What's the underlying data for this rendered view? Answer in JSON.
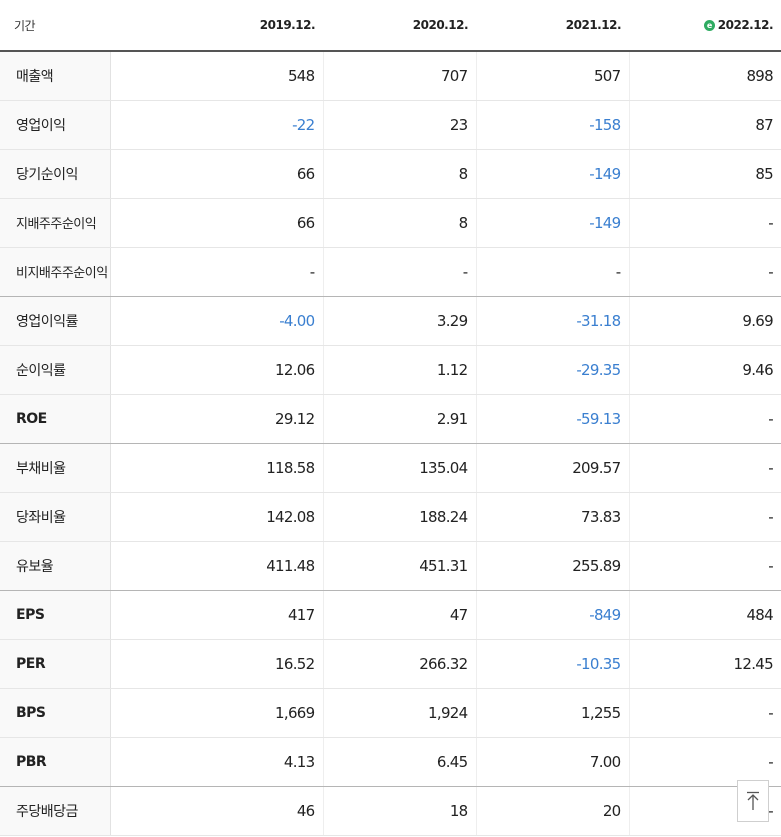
{
  "header": {
    "label": "기간",
    "periods": [
      "2019.12.",
      "2020.12.",
      "2021.12.",
      "2022.12."
    ],
    "estimate_icon": "estimate-badge-icon"
  },
  "rows": [
    {
      "label": "매출액",
      "values": [
        "548",
        "707",
        "507",
        "898"
      ]
    },
    {
      "label": "영업이익",
      "values": [
        "-22",
        "23",
        "-158",
        "87"
      ]
    },
    {
      "label": "당기순이익",
      "values": [
        "66",
        "8",
        "-149",
        "85"
      ]
    },
    {
      "label": "지배주주순이익",
      "values": [
        "66",
        "8",
        "-149",
        "-"
      ]
    },
    {
      "label": "비지배주주순이익",
      "values": [
        "-",
        "-",
        "-",
        "-"
      ]
    },
    {
      "label": "영업이익률",
      "values": [
        "-4.00",
        "3.29",
        "-31.18",
        "9.69"
      ]
    },
    {
      "label": "순이익률",
      "values": [
        "12.06",
        "1.12",
        "-29.35",
        "9.46"
      ]
    },
    {
      "label": "ROE",
      "values": [
        "29.12",
        "2.91",
        "-59.13",
        "-"
      ]
    },
    {
      "label": "부채비율",
      "values": [
        "118.58",
        "135.04",
        "209.57",
        "-"
      ]
    },
    {
      "label": "당좌비율",
      "values": [
        "142.08",
        "188.24",
        "73.83",
        "-"
      ]
    },
    {
      "label": "유보율",
      "values": [
        "411.48",
        "451.31",
        "255.89",
        "-"
      ]
    },
    {
      "label": "EPS",
      "values": [
        "417",
        "47",
        "-849",
        "484"
      ]
    },
    {
      "label": "PER",
      "values": [
        "16.52",
        "266.32",
        "-10.35",
        "12.45"
      ]
    },
    {
      "label": "BPS",
      "values": [
        "1,669",
        "1,924",
        "1,255",
        "-"
      ]
    },
    {
      "label": "PBR",
      "values": [
        "4.13",
        "6.45",
        "7.00",
        "-"
      ]
    },
    {
      "label": "주당배당금",
      "values": [
        "46",
        "18",
        "20",
        "-"
      ]
    }
  ],
  "colors": {
    "negative": "#3a7fd0",
    "estimate_badge": "#2eab61"
  },
  "scroll_top_icon": "arrow-up-icon"
}
